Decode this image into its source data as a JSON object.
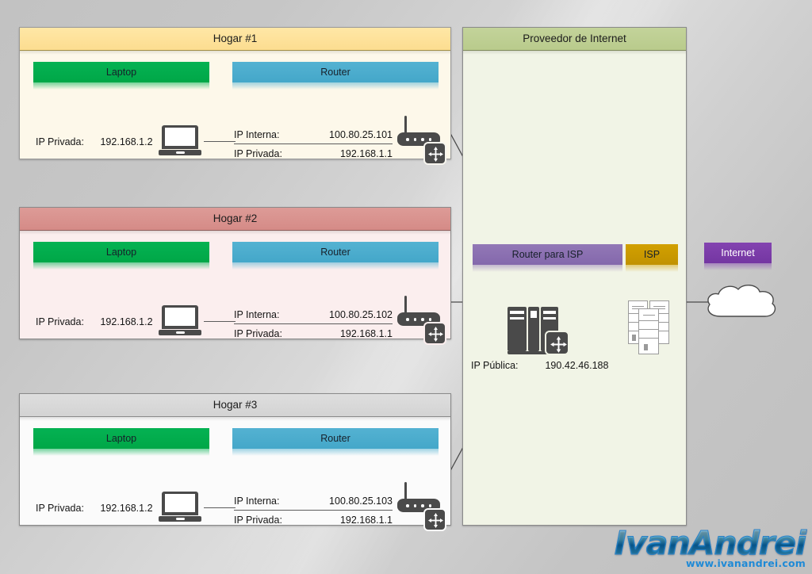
{
  "homes": [
    {
      "title": "Hogar #1",
      "laptop_label": "Laptop",
      "router_label": "Router",
      "laptop_ip_label": "IP Privada:",
      "laptop_ip_value": "192.168.1.2",
      "router_internal_label": "IP Interna:",
      "router_internal_value": "100.80.25.101",
      "router_private_label": "IP Privada:",
      "router_private_value": "192.168.1.1",
      "header_color": "#ffe49c",
      "body_color": "#fdf8ea"
    },
    {
      "title": "Hogar #2",
      "laptop_label": "Laptop",
      "router_label": "Router",
      "laptop_ip_label": "IP Privada:",
      "laptop_ip_value": "192.168.1.2",
      "router_internal_label": "IP Interna:",
      "router_internal_value": "100.80.25.102",
      "router_private_label": "IP Privada:",
      "router_private_value": "192.168.1.1",
      "header_color": "#d99490",
      "body_color": "#fbeeee"
    },
    {
      "title": "Hogar #3",
      "laptop_label": "Laptop",
      "router_label": "Router",
      "laptop_ip_label": "IP Privada:",
      "laptop_ip_value": "192.168.1.2",
      "router_internal_label": "IP Interna:",
      "router_internal_value": "100.80.25.103",
      "router_private_label": "IP Privada:",
      "router_private_value": "192.168.1.1",
      "header_color": "#d9d9d9",
      "body_color": "#fbfbfb"
    }
  ],
  "isp": {
    "title": "Proveedor de Internet",
    "router_label": "Router para ISP",
    "isp_label": "ISP",
    "internet_label": "Internet",
    "public_ip_label": "IP Pública:",
    "public_ip_value": "190.42.46.188",
    "header_color": "#c3d39a",
    "body_color": "#f1f4e6",
    "router_chip_color": "#8468ac",
    "isp_chip_color": "#c19200",
    "internet_chip_color": "#7436a2"
  },
  "icons": {
    "laptop": "laptop-icon",
    "wifi_router": "wifi-router-icon",
    "isp_router": "isp-router-icon",
    "servers": "server-stack-icon",
    "cloud": "internet-cloud-icon"
  },
  "watermark": {
    "brand": "IvanAndrei",
    "url": "www.ivanandrei.com"
  },
  "palette": {
    "laptop_chip": "#00a747",
    "router_chip": "#44a7c9",
    "device_dark": "#4a4a4a",
    "wire": "#5c5c5c",
    "background": "#c9c9c9"
  }
}
